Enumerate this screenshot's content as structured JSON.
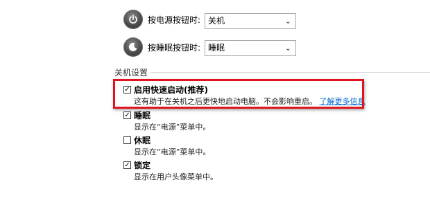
{
  "power_button": {
    "label": "按电源按钮时:",
    "value": "关机"
  },
  "sleep_button": {
    "label": "按睡眠按钮时:",
    "value": "睡眠"
  },
  "shutdown_settings": {
    "title": "关机设置",
    "options": [
      {
        "title": "启用快速启动(推荐)",
        "desc": "这有助于在关机之后更快地启动电脑。不会影响重启。",
        "link": "了解更多信息",
        "checked": true
      },
      {
        "title": "睡眠",
        "desc": "显示在“电源”菜单中。",
        "checked": true
      },
      {
        "title": "休眠",
        "desc": "显示在“电源”菜单中。",
        "checked": false
      },
      {
        "title": "锁定",
        "desc": "显示在用户头像菜单中。",
        "checked": true
      }
    ]
  },
  "colors": {
    "highlight": "#e0141e",
    "link": "#0066cc"
  },
  "icons": {
    "chevron": "chevron-down-icon",
    "check": "checkmark-icon"
  }
}
